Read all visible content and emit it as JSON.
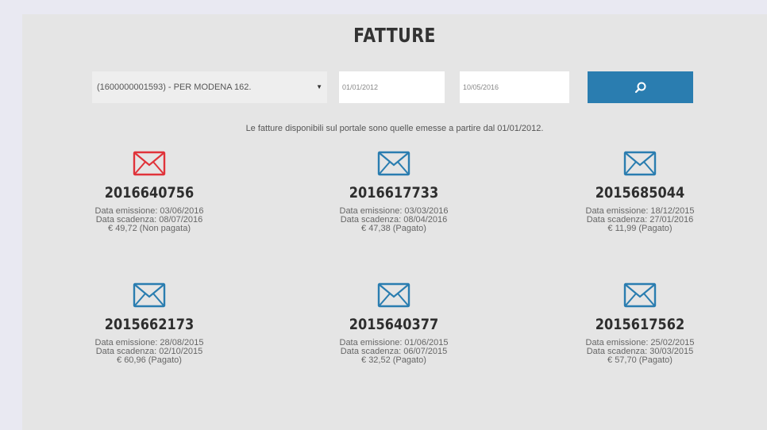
{
  "page": {
    "title": "FATTURE",
    "notice": "Le fatture disponibili sul portale sono quelle emesse a partire dal 01/01/2012."
  },
  "filters": {
    "contract_select": "(1600000001593) - PER MODENA 162.",
    "date_from": "01/01/2012",
    "date_to": "10/05/2016",
    "search_icon": "search-icon"
  },
  "colors": {
    "unpaid": "#e0333a",
    "paid": "#2a7db0",
    "button": "#2a7db0"
  },
  "invoices": [
    {
      "number": "2016640756",
      "issued": "Data emissione: 03/06/2016",
      "due": "Data scadenza: 08/07/2016",
      "amount": "€ 49,72 (Non pagata)",
      "status": "unpaid"
    },
    {
      "number": "2016617733",
      "issued": "Data emissione: 03/03/2016",
      "due": "Data scadenza: 08/04/2016",
      "amount": "€ 47,38 (Pagato)",
      "status": "paid"
    },
    {
      "number": "2015685044",
      "issued": "Data emissione: 18/12/2015",
      "due": "Data scadenza: 27/01/2016",
      "amount": "€ 11,99 (Pagato)",
      "status": "paid"
    },
    {
      "number": "2015662173",
      "issued": "Data emissione: 28/08/2015",
      "due": "Data scadenza: 02/10/2015",
      "amount": "€ 60,96 (Pagato)",
      "status": "paid"
    },
    {
      "number": "2015640377",
      "issued": "Data emissione: 01/06/2015",
      "due": "Data scadenza: 06/07/2015",
      "amount": "€ 32,52 (Pagato)",
      "status": "paid"
    },
    {
      "number": "2015617562",
      "issued": "Data emissione: 25/02/2015",
      "due": "Data scadenza: 30/03/2015",
      "amount": "€ 57,70 (Pagato)",
      "status": "paid"
    }
  ]
}
